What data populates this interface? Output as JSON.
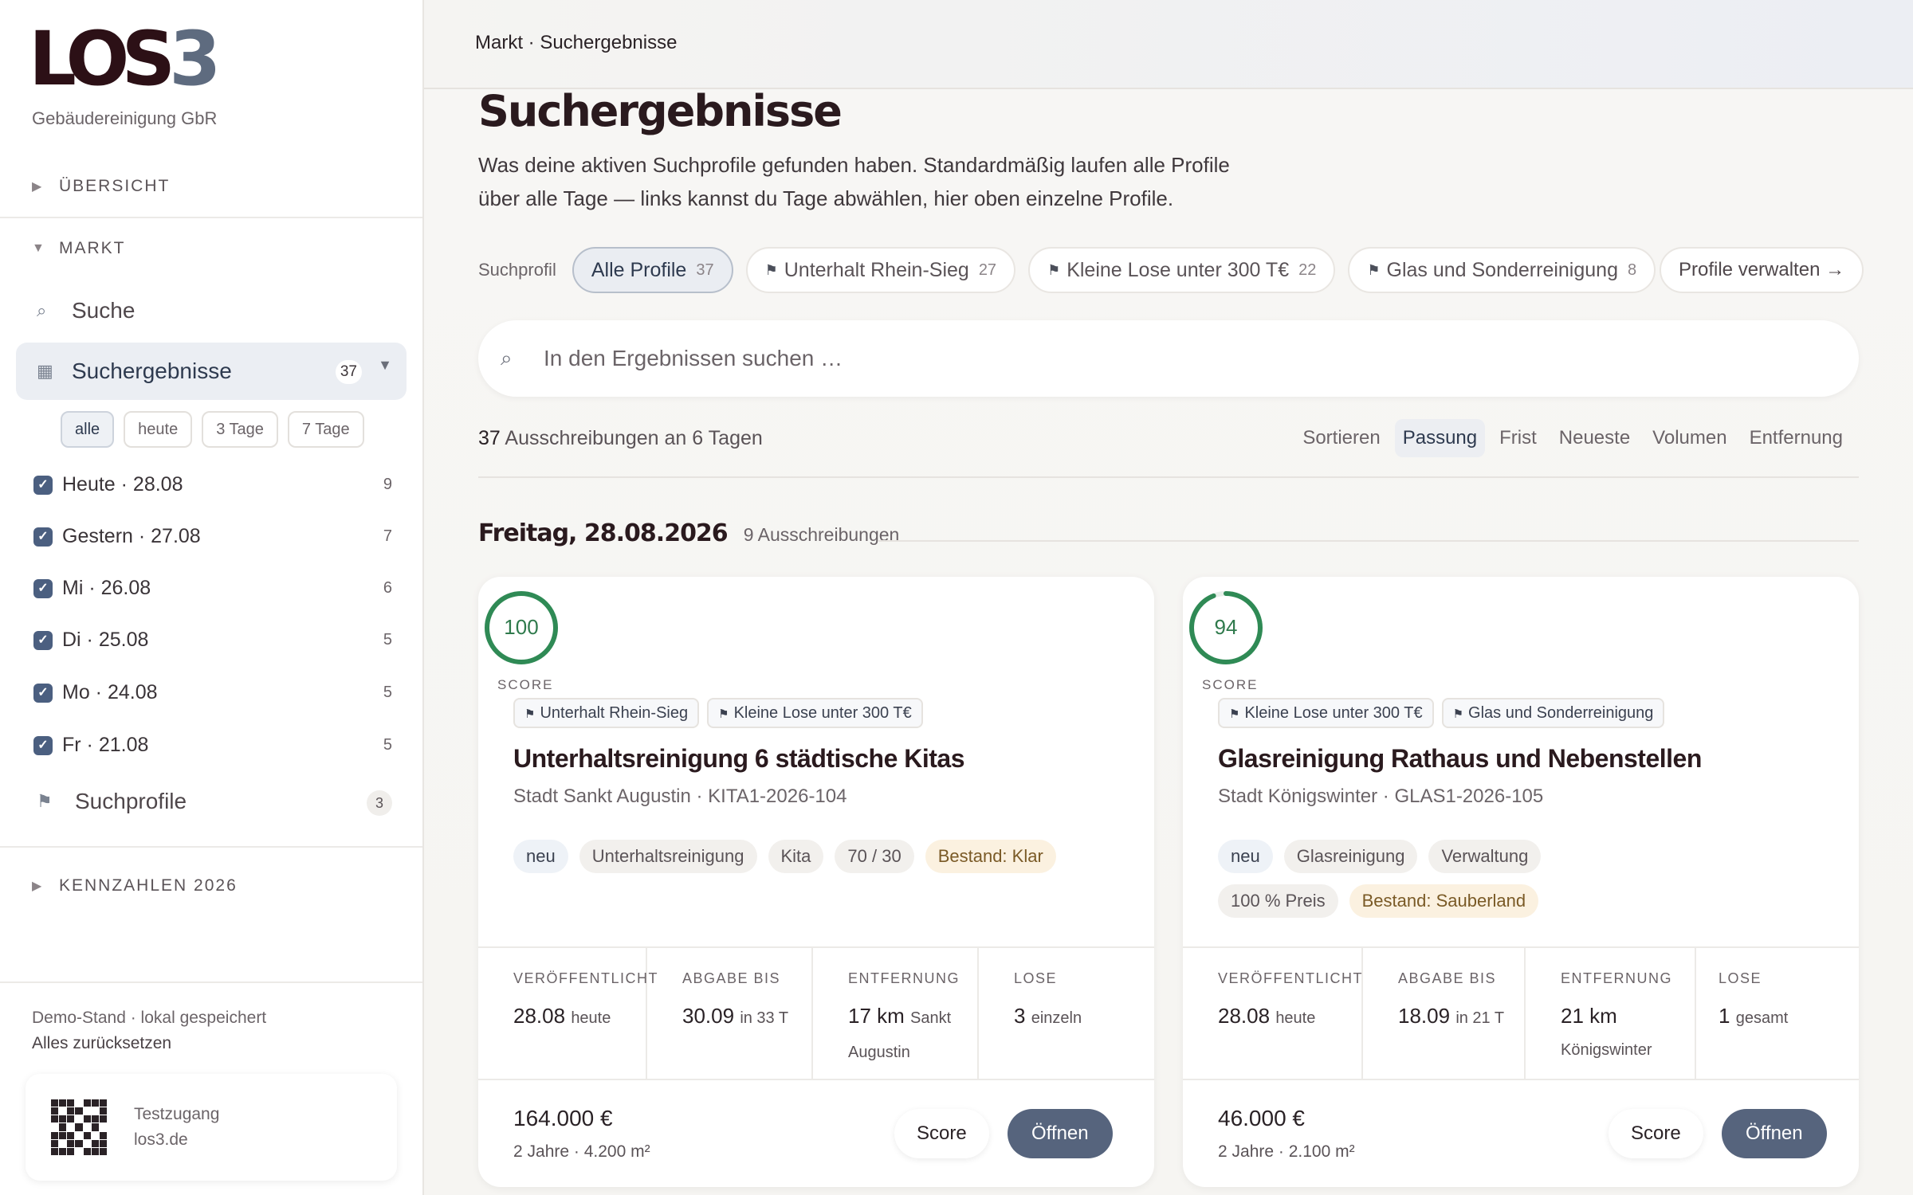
{
  "brand": {
    "logo_main": "LOS",
    "logo_num": "3",
    "company": "Gebäudereinigung GbR"
  },
  "sidebar": {
    "overview": "ÜBERSICHT",
    "market": "MARKT",
    "nav_search": "Suche",
    "nav_results": "Suchergebnisse",
    "nav_results_count": "37",
    "day_filters": [
      "alle",
      "heute",
      "3 Tage",
      "7 Tage"
    ],
    "days": [
      {
        "label": "Heute · 28.08",
        "count": "9"
      },
      {
        "label": "Gestern · 27.08",
        "count": "7"
      },
      {
        "label": "Mi · 26.08",
        "count": "6"
      },
      {
        "label": "Di · 25.08",
        "count": "5"
      },
      {
        "label": "Mo · 24.08",
        "count": "5"
      },
      {
        "label": "Fr · 21.08",
        "count": "5"
      }
    ],
    "profiles_label": "Suchprofile",
    "profiles_count": "3",
    "kpis": "KENNZAHLEN 2026",
    "demo_line": "Demo-Stand · lokal gespeichert",
    "reset": "Alles zurücksetzen",
    "test_access": "Testzugang",
    "test_url": "los3.de"
  },
  "header": {
    "breadcrumb": "Markt · Suchergebnisse"
  },
  "main": {
    "title": "Suchergebnisse",
    "intro": "Was deine aktiven Suchprofile gefunden haben. Standardmäßig laufen alle Profile über alle Tage — links kannst du Tage abwählen, hier oben einzelne Profile.",
    "profile_label": "Suchprofil",
    "profiles": [
      {
        "name": "Alle Profile",
        "count": "37"
      },
      {
        "name": "Unterhalt Rhein-Sieg",
        "count": "27"
      },
      {
        "name": "Kleine Lose unter 300 T€",
        "count": "22"
      },
      {
        "name": "Glas und Sonderreinigung",
        "count": "8"
      }
    ],
    "manage": "Profile verwalten →",
    "search_placeholder": "In den Ergebnissen suchen …",
    "count_num": "37",
    "count_text": "Ausschreibungen an 6 Tagen",
    "sort_label": "Sortieren",
    "sort_options": [
      "Passung",
      "Frist",
      "Neueste",
      "Volumen",
      "Entfernung"
    ],
    "day_title": "Freitag, 28.08.2026",
    "day_count": "9 Ausschreibungen"
  },
  "cards": [
    {
      "score": "100",
      "score_value": 100,
      "score_label": "SCORE",
      "profiles": [
        "Unterhalt Rhein-Sieg",
        "Kleine Lose unter 300 T€"
      ],
      "title": "Unterhaltsreinigung 6 städtische Kitas",
      "subtitle": "Stadt Sankt Augustin · KITA1-2026-104",
      "pills": [
        "neu",
        "Unterhaltsreinigung",
        "Kita",
        "70 / 30",
        "Bestand: Klar"
      ],
      "stats": [
        {
          "key": "VERÖFFENTLICHT",
          "value": "28.08",
          "note": "heute"
        },
        {
          "key": "ABGABE BIS",
          "value": "30.09",
          "note": "in 33 T"
        },
        {
          "key": "ENTFERNUNG",
          "value": "17 km",
          "note": "Sankt Augustin"
        },
        {
          "key": "LOSE",
          "value": "3",
          "note": "einzeln"
        }
      ],
      "price": "164.000 €",
      "price_sub": "2 Jahre · 4.200 m²",
      "btn_score": "Score",
      "btn_open": "Öffnen"
    },
    {
      "score": "94",
      "score_value": 94,
      "score_label": "SCORE",
      "profiles": [
        "Kleine Lose unter 300 T€",
        "Glas und Sonderreinigung"
      ],
      "title": "Glasreinigung Rathaus und Nebenstellen",
      "subtitle": "Stadt Königswinter · GLAS1-2026-105",
      "pills": [
        "neu",
        "Glasreinigung",
        "Verwaltung",
        "100 % Preis",
        "Bestand: Sauberland"
      ],
      "stats": [
        {
          "key": "VERÖFFENTLICHT",
          "value": "28.08",
          "note": "heute"
        },
        {
          "key": "ABGABE BIS",
          "value": "18.09",
          "note": "in 21 T"
        },
        {
          "key": "ENTFERNUNG",
          "value": "21 km",
          "note": "Königswinter"
        },
        {
          "key": "LOSE",
          "value": "1",
          "note": "gesamt"
        }
      ],
      "price": "46.000 €",
      "price_sub": "2 Jahre · 2.100 m²",
      "btn_score": "Score",
      "btn_open": "Öffnen"
    }
  ],
  "colors": {
    "accent": "#56647d",
    "score_ring": "#2f8a55",
    "logo": "#2c1016"
  }
}
